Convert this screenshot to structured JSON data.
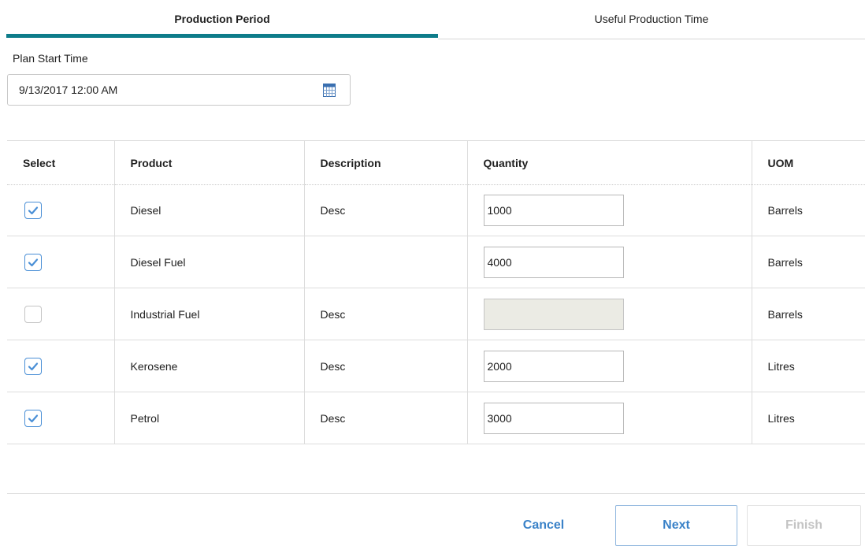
{
  "tabs": [
    {
      "label": "Production Period",
      "active": true
    },
    {
      "label": "Useful Production Time",
      "active": false
    }
  ],
  "plan_start": {
    "label": "Plan Start Time",
    "value": "9/13/2017 12:00 AM",
    "icon": "calendar-icon"
  },
  "table": {
    "headers": [
      "Select",
      "Product",
      "Description",
      "Quantity",
      "UOM"
    ],
    "rows": [
      {
        "selected": true,
        "product": "Diesel",
        "description": "Desc",
        "quantity": "1000",
        "uom": "Barrels"
      },
      {
        "selected": true,
        "product": "Diesel Fuel",
        "description": "",
        "quantity": "4000",
        "uom": "Barrels"
      },
      {
        "selected": false,
        "product": "Industrial Fuel",
        "description": "Desc",
        "quantity": "",
        "uom": "Barrels"
      },
      {
        "selected": true,
        "product": "Kerosene",
        "description": "Desc",
        "quantity": "2000",
        "uom": "Litres"
      },
      {
        "selected": true,
        "product": "Petrol",
        "description": "Desc",
        "quantity": "3000",
        "uom": "Litres"
      }
    ]
  },
  "footer": {
    "cancel_label": "Cancel",
    "next_label": "Next",
    "finish_label": "Finish"
  },
  "colors": {
    "accent": "#0e7c8a",
    "link": "#3a82c8",
    "checkbox": "#4a8fd6",
    "disabled": "#c4c4c4"
  }
}
